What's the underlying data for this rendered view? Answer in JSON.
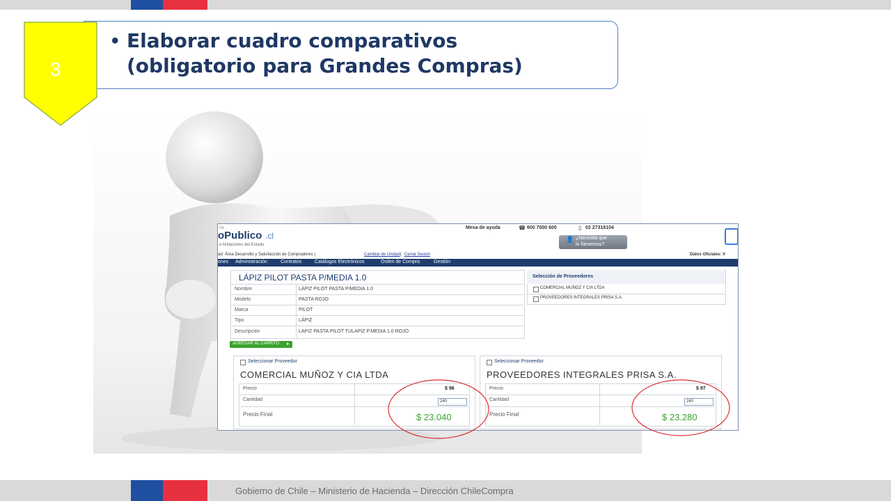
{
  "slide": {
    "step_number": "3",
    "bullet": "•",
    "title_line1": "Elaborar cuadro comparativos",
    "title_line2": "(obligatorio para Grandes Compras)",
    "footer": "Gobierno de Chile – Ministerio de Hacienda – Dirección ChileCompra"
  },
  "colors": {
    "flag_blue": "#1f4fa0",
    "flag_red": "#e8313f",
    "title_text": "#1f3864",
    "step_yellow": "#ffff00",
    "price_green": "#3aa32f",
    "annotation_red": "#d93030"
  },
  "screenshot": {
    "logo_prefix": "ra",
    "logo_main": "oPublico",
    "logo_suffix": ".cl",
    "logo_sub": "e licitaciones del Estado",
    "help_label": "Mesa de ayuda",
    "help_phone1": "600 7000 600",
    "help_phone2": "02 27318104",
    "call_button_line1": "¿Necesita que",
    "call_button_line2": "lo llamemos?",
    "unit_prefix": "ad: Área Desarrollo y Satisfacción de Compradores |",
    "unit_change_link": "Cambiar de Unidad",
    "unit_separator": "|",
    "logout_link": "Cerrar Sesión",
    "official_data": "Datos Oficiales: V",
    "nav": [
      "ones",
      "Administración",
      "Contratos",
      "Catálogos Electrónicos",
      "Orden de Compra",
      "Gestión"
    ],
    "product": {
      "title": "LÁPIZ PILOT PASTA P/MEDIA 1.0",
      "rows": [
        {
          "label": "Nombre",
          "value": "LÁPIZ PILOT PASTA P/MEDIA 1.0"
        },
        {
          "label": "Modelo",
          "value": "PASTA ROJO"
        },
        {
          "label": "Marca",
          "value": "PILOT"
        },
        {
          "label": "Tipo",
          "value": "LÁPIZ"
        },
        {
          "label": "Descripción",
          "value": "LAPIZ PASTA PILOT TULAPIZ P.MEDIA 1.0 ROJO"
        }
      ],
      "cart_button": "AGREGAR AL CARRITO"
    },
    "supplier_selection": {
      "header": "Selección de Proveedores",
      "items": [
        "COMERCIAL MUÑOZ Y CIA LTDA",
        "PROVEEDORES INTEGRALES PRISA S.A."
      ]
    },
    "suppliers": [
      {
        "select_label": "Seleccionar Proveedor",
        "name": "COMERCIAL MUÑOZ Y CIA LTDA",
        "price_label": "Precio",
        "price": "$ 96",
        "qty_label": "Cantidad",
        "qty": "240",
        "final_label": "Precio Final",
        "final": "$ 23.040"
      },
      {
        "select_label": "Seleccionar Proveedor",
        "name": "PROVEEDORES INTEGRALES PRISA S.A.",
        "price_label": "Precio",
        "price": "$ 97",
        "qty_label": "Cantidad",
        "qty": "240",
        "final_label": "Precio Final",
        "final": "$ 23.280"
      }
    ]
  }
}
